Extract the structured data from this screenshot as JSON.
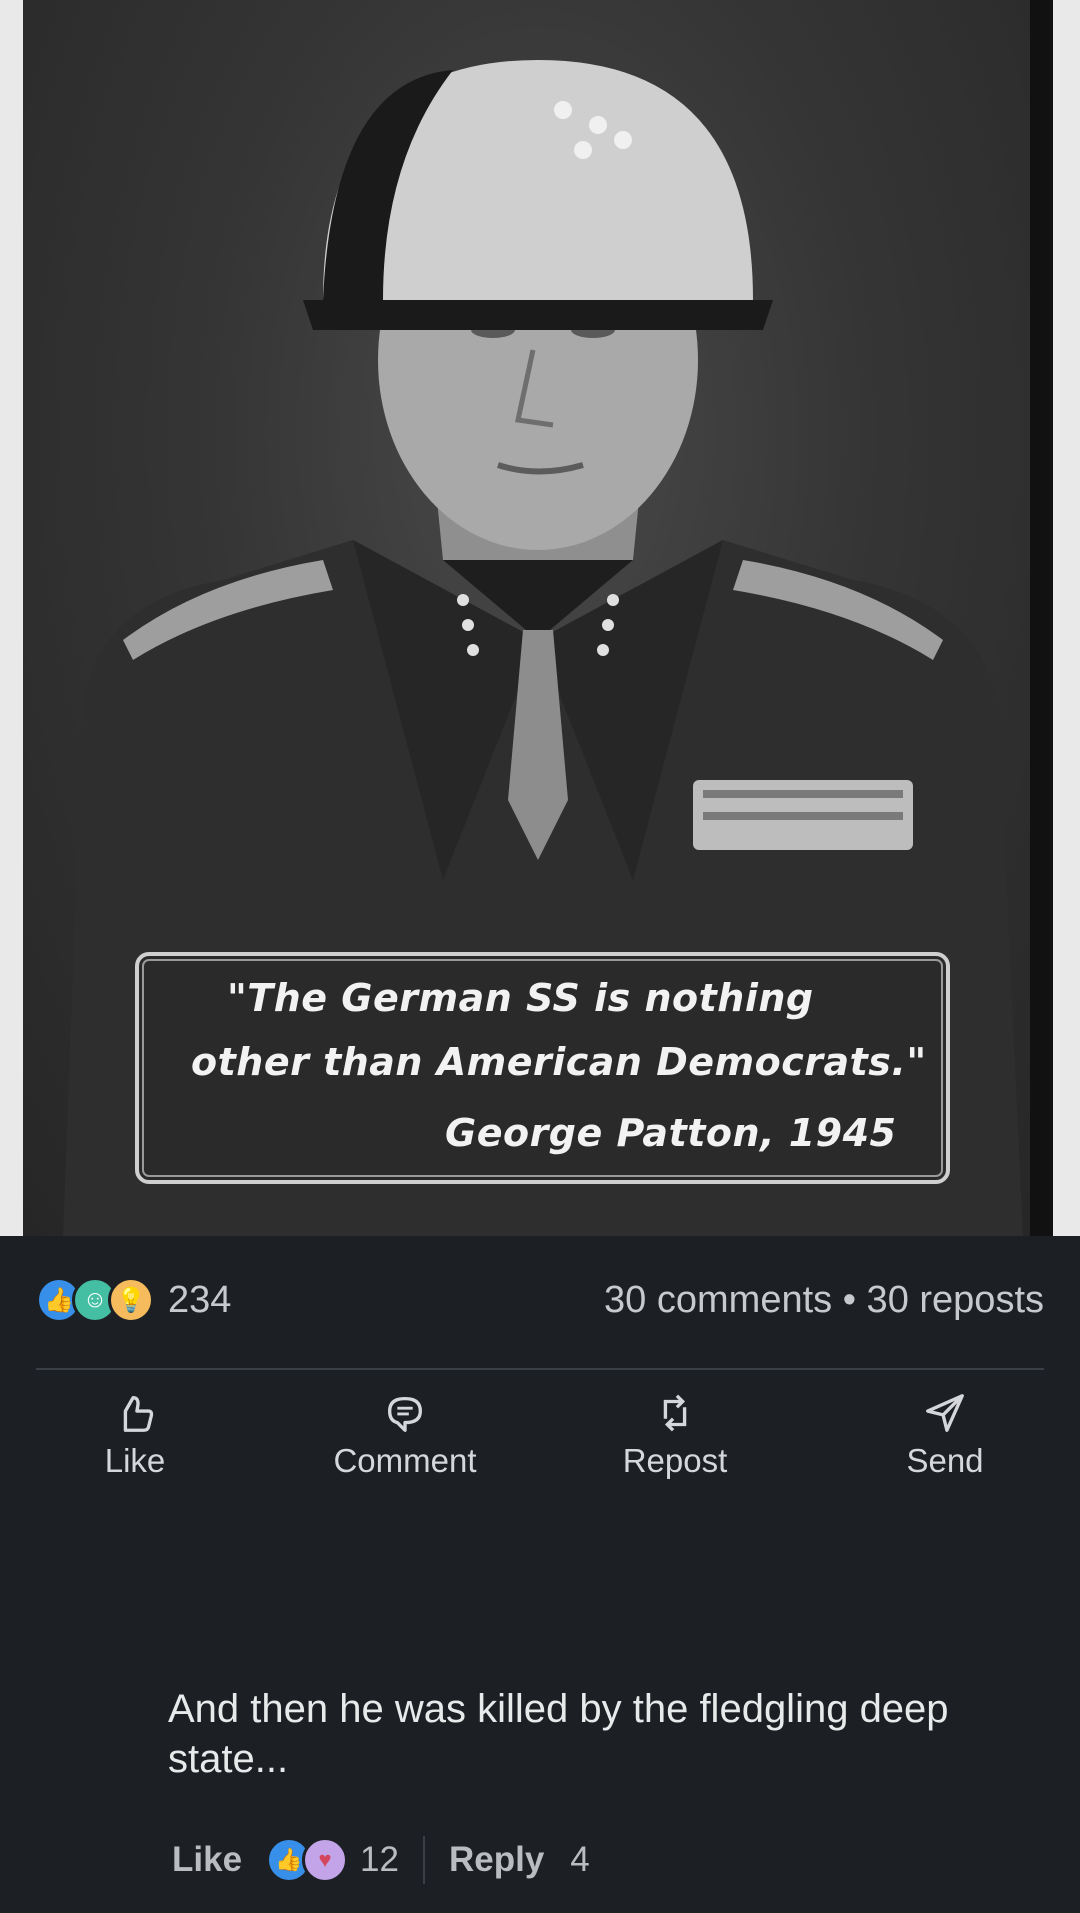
{
  "post_image": {
    "quote_line1": "\"The German SS is nothing",
    "quote_line2": "other than American Democrats.\"",
    "attribution": "George Patton, 1945"
  },
  "social_stats": {
    "reaction_icons": [
      "like-icon",
      "celebrate-icon",
      "insightful-icon"
    ],
    "reaction_count": "234",
    "comments_reposts": "30 comments • 30 reposts"
  },
  "actions": {
    "like": "Like",
    "comment": "Comment",
    "repost": "Repost",
    "send": "Send"
  },
  "comment": {
    "text": "And then he was killed by the fledgling deep state...",
    "like_label": "Like",
    "reaction_icons": [
      "like-icon",
      "love-icon"
    ],
    "reaction_count": "12",
    "reply_label": "Reply",
    "reply_count": "4"
  },
  "colors": {
    "background": "#1c2024",
    "like_blue": "#378fe9",
    "celebrate_green": "#44bfa3",
    "insight_yellow": "#f5bb5c"
  }
}
